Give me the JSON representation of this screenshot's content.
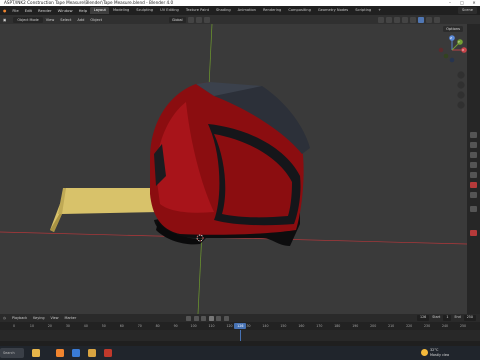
{
  "window": {
    "title": "ASPT/INK2 Construction Tape Measure\\Blender\\Tape Measure.blend - Blender 4.0",
    "controls": [
      "–",
      "□",
      "✕"
    ]
  },
  "menubar": {
    "menus": [
      "File",
      "Edit",
      "Render",
      "Window",
      "Help"
    ],
    "workspaces": [
      "Layout",
      "Modeling",
      "Sculpting",
      "UV Editing",
      "Texture Paint",
      "Shading",
      "Animation",
      "Rendering",
      "Compositing",
      "Geometry Nodes",
      "Scripting",
      "+"
    ],
    "active_workspace": "Layout",
    "scene": "Scene"
  },
  "viewport_header": {
    "mode": "Object Mode",
    "menus": [
      "View",
      "Select",
      "Add",
      "Object"
    ],
    "orientation": "Global",
    "options": "Options"
  },
  "timeline": {
    "menus": [
      "Playback",
      "Keying",
      "View",
      "Marker"
    ],
    "start_label": "Start",
    "start": "1",
    "end_label": "End",
    "end": "250",
    "current_frame": "126",
    "ticks": [
      "0",
      "10",
      "20",
      "30",
      "40",
      "50",
      "60",
      "70",
      "80",
      "90",
      "100",
      "110",
      "120",
      "130",
      "140",
      "150",
      "160",
      "170",
      "180",
      "190",
      "200",
      "210",
      "220",
      "230",
      "240",
      "250"
    ]
  },
  "gizmo": {
    "x_label": "X",
    "y_label": "Y",
    "z_label": "Z"
  },
  "taskbar": {
    "search_placeholder": "Search",
    "temperature": "32°C",
    "weather": "Mostly clea"
  },
  "colors": {
    "accent": "#4772b3",
    "tape_body": "#8b0d10",
    "tape_blade": "#d8c26a",
    "viewport_bg": "#3a3a3a",
    "axis_x": "#b4373a",
    "axis_y": "#6f9c2d"
  },
  "icons": [
    "blender-logo-icon",
    "gizmo-axis-icon",
    "zoom-icon",
    "hand-pan-icon",
    "camera-icon",
    "grid-icon",
    "play-icon",
    "windows-start-icon",
    "weather-sun-icon"
  ]
}
